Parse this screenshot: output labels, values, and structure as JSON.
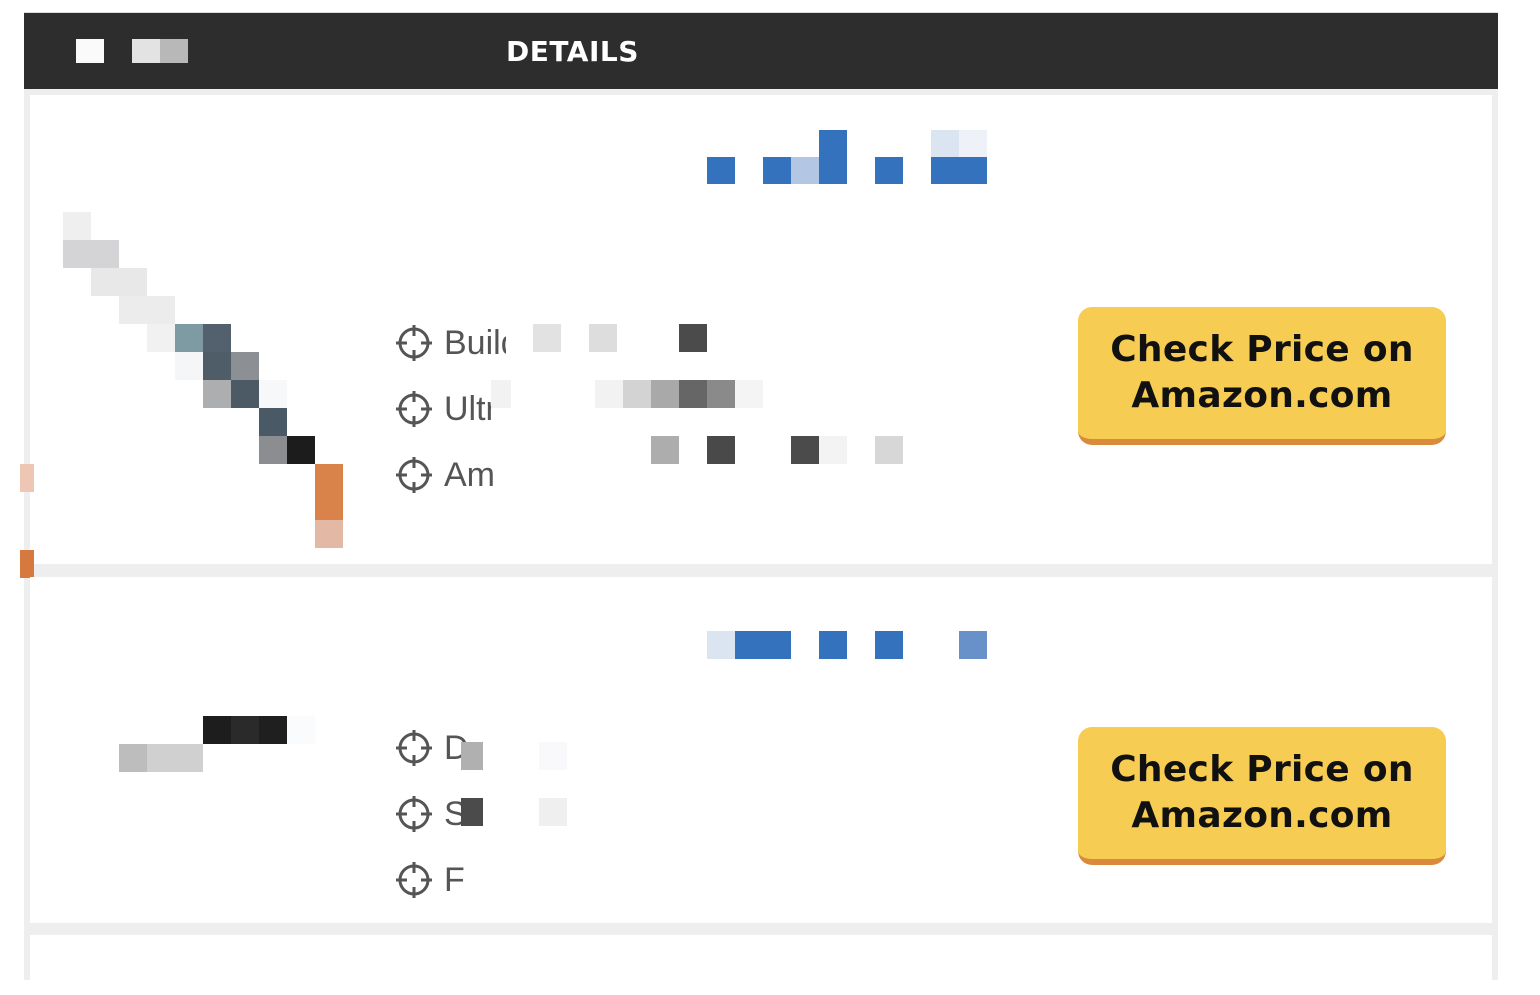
{
  "header": {
    "title": "DETAILS"
  },
  "products": [
    {
      "features": [
        "Build for the trail",
        "Ultr",
        "Am"
      ],
      "button": {
        "line1": "Check Price on",
        "line2": "Amazon.com"
      }
    },
    {
      "features": [
        "D",
        "S",
        "F"
      ],
      "button": {
        "line1": "Check Price on",
        "line2": "Amazon.com"
      }
    }
  ],
  "colors": {
    "header_bg": "#2c2d2c",
    "button_bg": "#f6cc52",
    "button_border": "#d98a3a",
    "title_blue": "#3572bd"
  },
  "icons": {
    "feature_bullet": "target-icon"
  }
}
